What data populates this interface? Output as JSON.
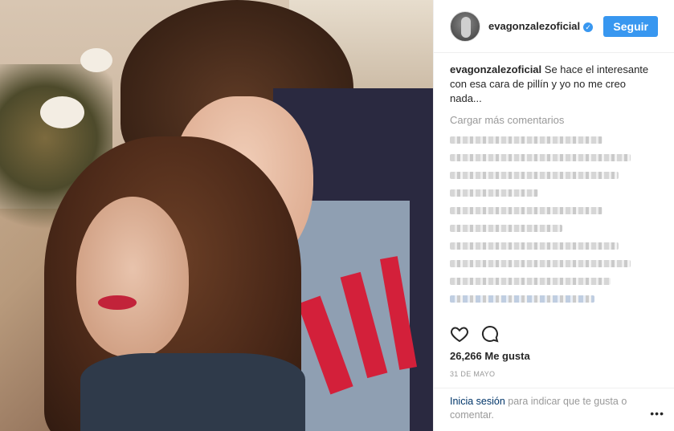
{
  "post": {
    "username": "evagonzalezoficial",
    "verified_mark": "✓",
    "follow_label": "Seguir",
    "caption_username": "evagonzalezoficial",
    "caption_text": "Se hace el interesante con esa cara de pillín y yo no me creo nada...",
    "load_more": "Cargar más comentarios",
    "likes": "26,266 Me gusta",
    "date": "31 DE MAYO",
    "login_link": "Inicia sesión",
    "login_text": " para indicar que te gusta o comentar.",
    "more_label": "•••"
  },
  "icons": {
    "like": "heart-icon",
    "comment": "comment-icon",
    "avatar": "avatar-image",
    "verified": "verified-badge-icon"
  },
  "colors": {
    "accent": "#3897f0",
    "link": "#003569",
    "muted": "#999999",
    "text": "#262626"
  }
}
